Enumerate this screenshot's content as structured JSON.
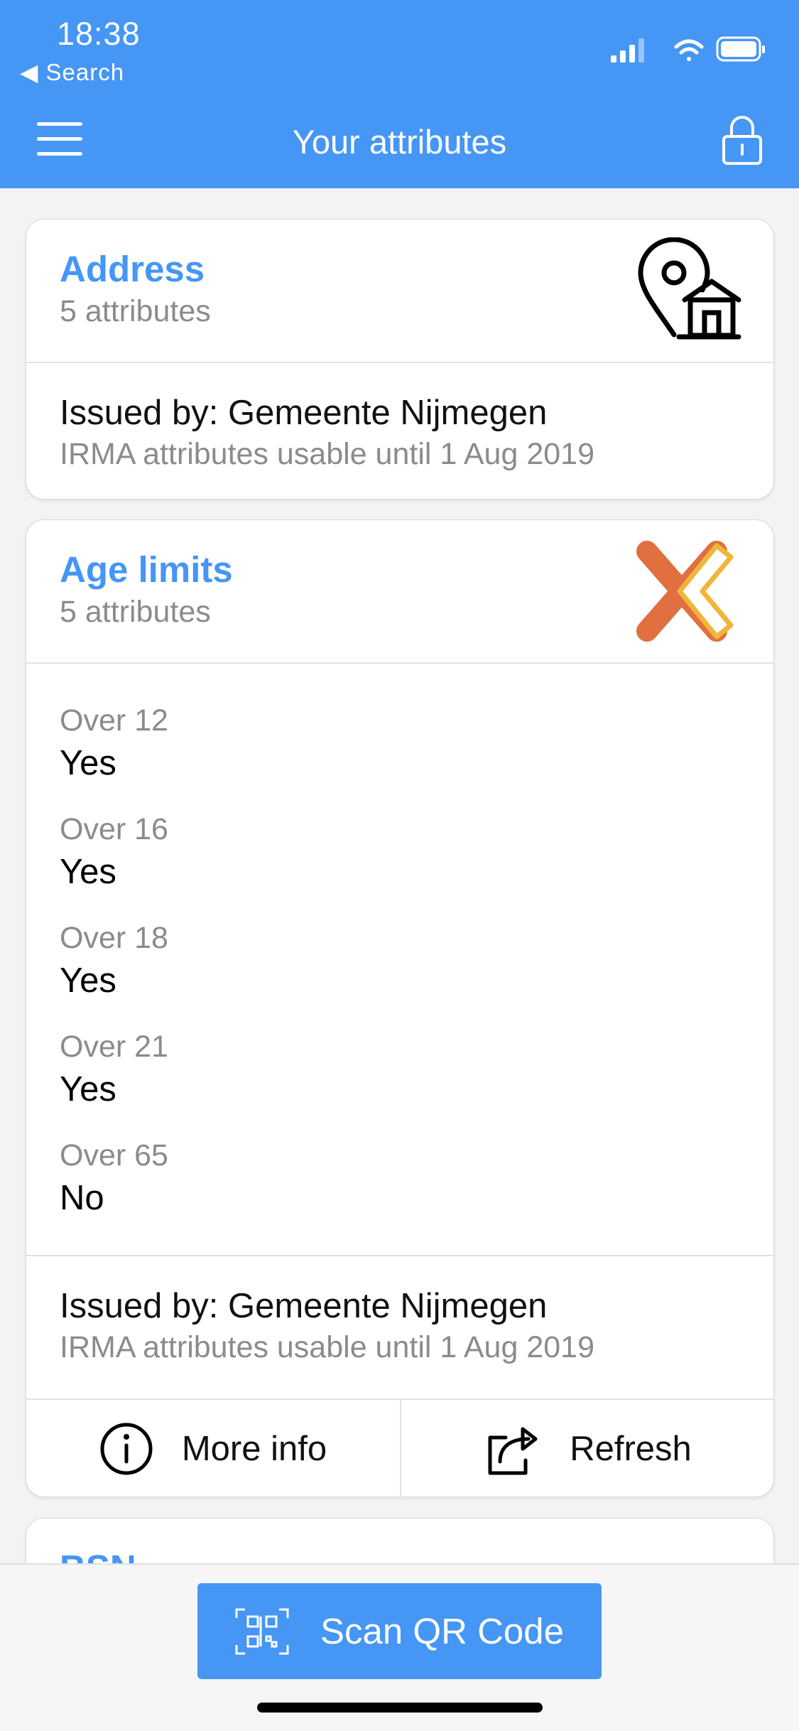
{
  "status": {
    "time": "18:38",
    "back_label": "◀ Search"
  },
  "header": {
    "title": "Your attributes",
    "menu_icon": "hamburger-menu-icon",
    "lock_icon": "lock-icon"
  },
  "cards": [
    {
      "title": "Address",
      "subtitle": "5 attributes",
      "icon": "location-house-icon",
      "issued_by": "Issued by: Gemeente Nijmegen",
      "usable_until": "IRMA attributes usable until 1 Aug 2019"
    },
    {
      "title": "Age limits",
      "subtitle": "5 attributes",
      "icon": "age-limits-logo-icon",
      "attributes": [
        {
          "label": "Over 12",
          "value": "Yes"
        },
        {
          "label": "Over 16",
          "value": "Yes"
        },
        {
          "label": "Over 18",
          "value": "Yes"
        },
        {
          "label": "Over 21",
          "value": "Yes"
        },
        {
          "label": "Over 65",
          "value": "No"
        }
      ],
      "issued_by": "Issued by: Gemeente Nijmegen",
      "usable_until": "IRMA attributes usable until 1 Aug 2019",
      "actions": {
        "more_info": "More info",
        "refresh": "Refresh"
      }
    },
    {
      "title": "BSN"
    }
  ],
  "bottom": {
    "scan_label": "Scan QR Code"
  },
  "colors": {
    "brand": "#4596f5",
    "accent_orange": "#e07040",
    "accent_yellow": "#f0b63a"
  }
}
